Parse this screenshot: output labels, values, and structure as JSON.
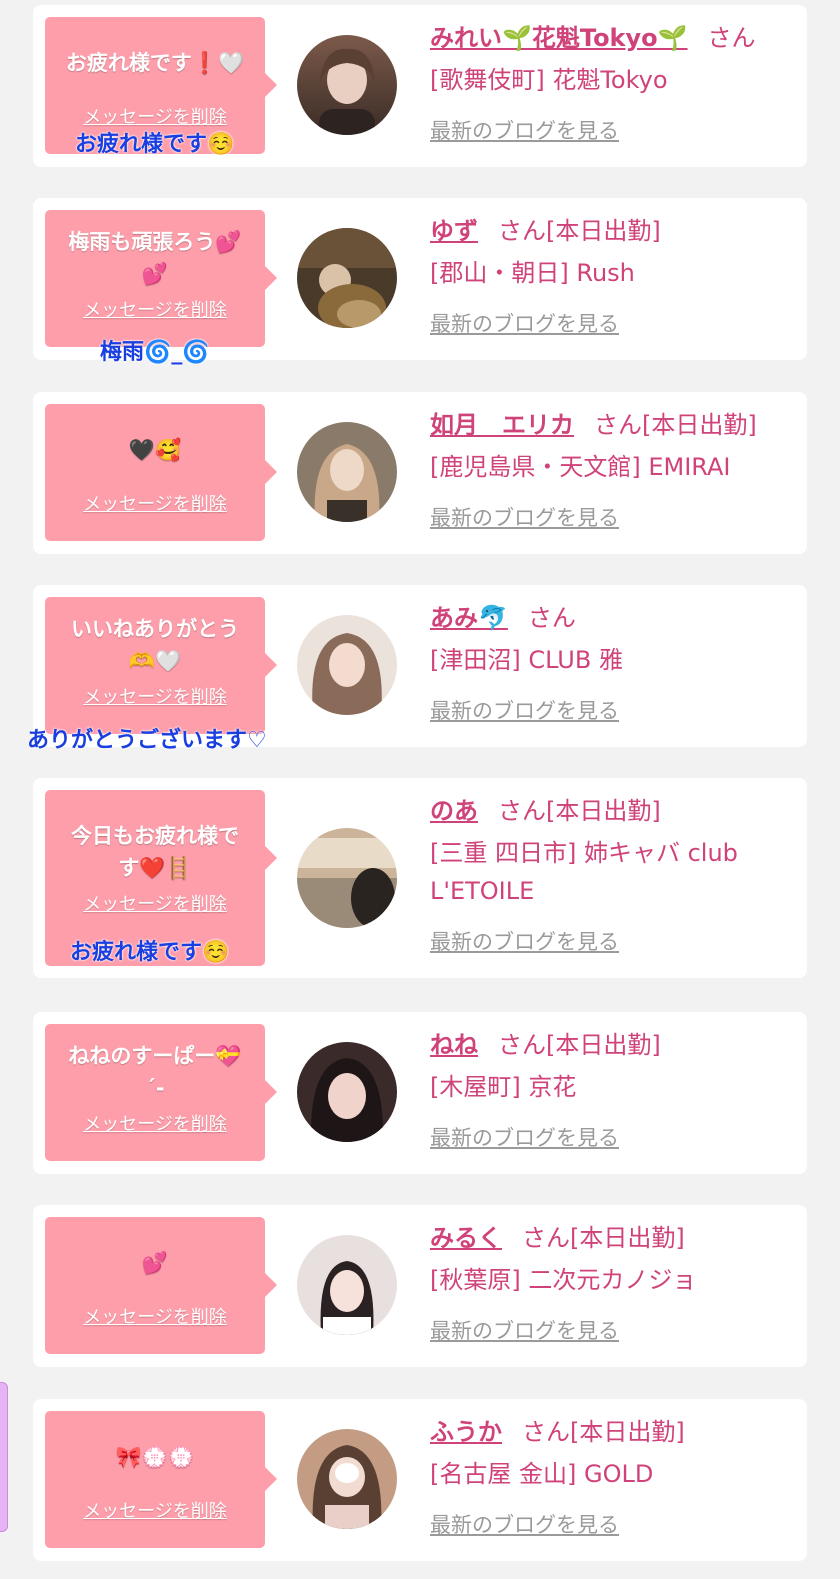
{
  "delete_label": "メッセージを削除",
  "blog_label": "最新のブログを見る",
  "cards": [
    {
      "message": "お疲れ様です❗🤍",
      "name": "みれい🌱花魁Tokyo🌱",
      "suffix": "さん",
      "shop": "[歌舞伎町] 花魁Tokyo",
      "reply": "お疲れ様です☺️",
      "avatar_colors": [
        "#7c5a4a",
        "#3a2c26"
      ]
    },
    {
      "message": "梅雨も頑張ろう💕\n💕",
      "name": "ゆず",
      "suffix": "さん[本日出勤]",
      "shop": "[郡山・朝日] Rush",
      "reply": "梅雨🌀_🌀",
      "avatar_colors": [
        "#6a5238",
        "#2b2016"
      ]
    },
    {
      "message": "🖤🥰",
      "name": "如月　エリカ",
      "suffix": "さん[本日出勤]",
      "shop": "[鹿児島県・天文館] EMIRAI",
      "reply": "",
      "avatar_colors": [
        "#b89a86",
        "#4a3a30"
      ]
    },
    {
      "message": "いいねありがとう\n🫶🤍",
      "name": "あみ🐬",
      "suffix": "さん",
      "shop": "[津田沼] CLUB 雅",
      "reply": "ありがとうございます♡",
      "avatar_colors": [
        "#d8bfae",
        "#8a6a58"
      ]
    },
    {
      "message": "今日もお疲れ様で\nす❤️🪜",
      "name": "のあ",
      "suffix": "さん[本日出勤]",
      "shop": "[三重 四日市] 姉キャバ club L'ETOILE",
      "reply": "お疲れ様です☺️",
      "avatar_colors": [
        "#cbb49a",
        "#2a2420"
      ]
    },
    {
      "message": "ねねのすーぱー💝\n´-",
      "name": "ねね",
      "suffix": "さん[本日出勤]",
      "shop": "[木屋町] 京花",
      "reply": "",
      "avatar_colors": [
        "#caa8a0",
        "#2a1e1e"
      ]
    },
    {
      "message": "💕",
      "name": "みるく",
      "suffix": "さん[本日出勤]",
      "shop": "[秋葉原] 二次元カノジョ",
      "reply": "",
      "avatar_colors": [
        "#e8e0de",
        "#5a4a48"
      ]
    },
    {
      "message": "🎀💮💮",
      "name": "ふうか",
      "suffix": "さん[本日出勤]",
      "shop": "[名古屋 金山] GOLD",
      "reply": "",
      "avatar_colors": [
        "#c49c84",
        "#5a4032"
      ]
    }
  ]
}
